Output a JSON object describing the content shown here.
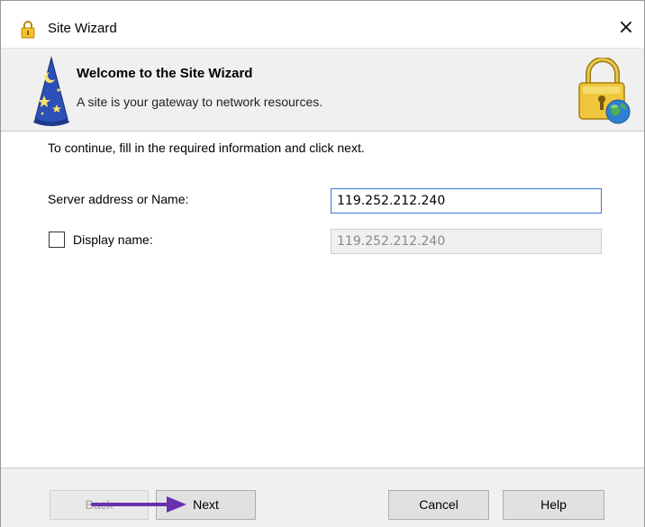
{
  "window": {
    "title": "Site Wizard",
    "close_glyph": "×"
  },
  "banner": {
    "title": "Welcome to the Site Wizard",
    "subtitle": "A site is your gateway to network resources."
  },
  "content": {
    "instruction": "To continue, fill in the required information and click next.",
    "server_label": "Server address or Name:",
    "server_value": "119.252.212.240",
    "display_checked": false,
    "display_label": "Display name:",
    "display_value": "119.252.212.240"
  },
  "footer": {
    "back_label": "Back",
    "next_label": "Next",
    "cancel_label": "Cancel",
    "help_label": "Help"
  },
  "colors": {
    "annotation_arrow": "#6a2fb0",
    "focus_border": "#3a78d6"
  },
  "icons": [
    "lock-icon",
    "wizard-hat-icon",
    "lock-globe-icon",
    "close-icon",
    "arrow-annotation"
  ]
}
